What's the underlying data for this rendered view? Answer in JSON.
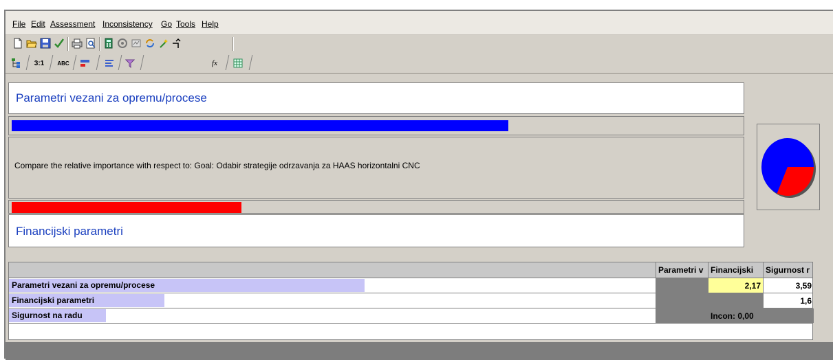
{
  "menu": [
    "File",
    "Edit",
    "Assessment",
    "Inconsistency",
    "Go",
    "Tools",
    "Help"
  ],
  "toolbar_icons": [
    "new-file-icon",
    "open-folder-icon",
    "save-icon",
    "check-icon",
    "print-icon",
    "print-preview-icon",
    "calculator-icon",
    "sensitivity-icon",
    "network-icon",
    "refresh-icon",
    "magic-wand-icon",
    "arrow-up-right-icon"
  ],
  "tabs": [
    {
      "name": "tab-tree",
      "label": ""
    },
    {
      "name": "tab-numerical",
      "label": "3:1"
    },
    {
      "name": "tab-verbal",
      "label": "ABC"
    },
    {
      "name": "tab-graphical",
      "label": ""
    },
    {
      "name": "tab-questionnaire",
      "label": ""
    },
    {
      "name": "tab-filter",
      "label": ""
    },
    {
      "name": "tab-formula",
      "label": "fx"
    },
    {
      "name": "tab-grid",
      "label": ""
    }
  ],
  "comparison": {
    "element1": "Parametri vezani za opremu/procese",
    "element1_weight": 0.684,
    "question": "Compare the relative importance with respect to: Goal: Odabir strategije odrzavanja za HAAS horizontalni CNC",
    "element2": "Financijski parametri",
    "element2_weight": 0.316,
    "colors": {
      "element1": "#0000ff",
      "element2": "#ff0000"
    }
  },
  "pie": {
    "blue_fraction": 0.684,
    "red_fraction": 0.316
  },
  "matrix": {
    "headers": [
      "Parametri v",
      "Financijski",
      "Sigurnost r"
    ],
    "rows": [
      {
        "label": "Parametri vezani za opremu/procese",
        "weight": 0.55,
        "cells": [
          "",
          "2,17",
          "3,59"
        ]
      },
      {
        "label": "Financijski parametri",
        "weight": 0.24,
        "cells": [
          "",
          "",
          "1,6"
        ]
      },
      {
        "label": "Sigurnost na radu",
        "weight": 0.15,
        "cells": [
          "",
          "Incon: 0,00",
          ""
        ]
      }
    ]
  }
}
